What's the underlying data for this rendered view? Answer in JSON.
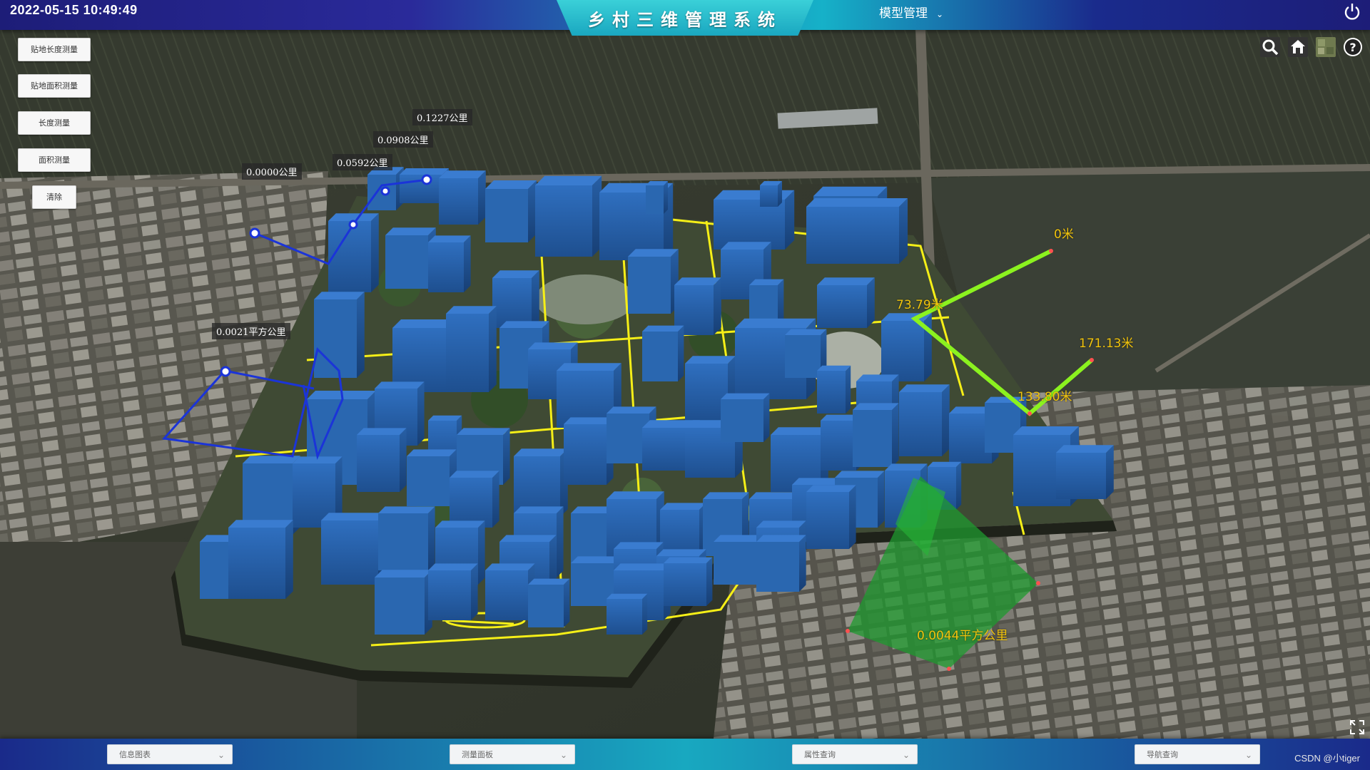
{
  "header": {
    "datetime": "2022-05-15  10:49:49",
    "title": "乡村三维管理系统",
    "model_menu_label": "模型管理"
  },
  "tools": {
    "ground_length": "贴地长度测量",
    "ground_area": "贴地面积测量",
    "length": "长度测量",
    "area": "面积测量",
    "clear": "清除"
  },
  "measurements": {
    "ground_length_labels": [
      "0.0000公里",
      "0.0592公里",
      "0.0908公里",
      "0.1227公里"
    ],
    "ground_area_label": "0.0021平方公里",
    "length_labels": [
      "0米",
      "73.79米",
      "133.80米",
      "171.13米"
    ],
    "area_label": "0.0044平方公里"
  },
  "right_icons": [
    "search-icon",
    "home-icon",
    "layer-icon",
    "help-icon"
  ],
  "bottom": {
    "selects": [
      "信息图表",
      "测量面板",
      "属性查询",
      "导航查询"
    ],
    "watermark": "CSDN @小tiger"
  },
  "colors": {
    "building": "#2a67b0",
    "ground_measure_line": "#1b34d8",
    "length_line": "#8bf21f",
    "area_fill": "#1f9a2f",
    "boundary": "#f6ef17",
    "label_yellow": "#f2c40c"
  }
}
